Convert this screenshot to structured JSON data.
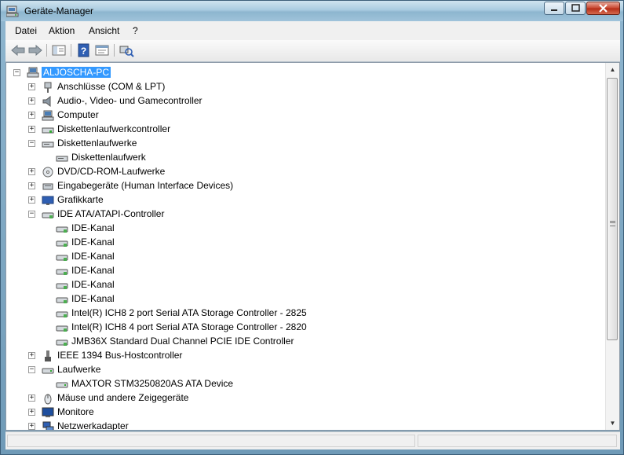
{
  "window": {
    "title": "Geräte-Manager"
  },
  "menu": {
    "items": [
      "Datei",
      "Aktion",
      "Ansicht",
      "?"
    ]
  },
  "tree": {
    "root": "ALJOSCHA-PC",
    "nodes": [
      {
        "label": "Anschlüsse (COM & LPT)",
        "icon": "port-icon",
        "expander": "+"
      },
      {
        "label": "Audio-, Video- und Gamecontroller",
        "icon": "speaker-icon",
        "expander": "+"
      },
      {
        "label": "Computer",
        "icon": "computer-icon",
        "expander": "+"
      },
      {
        "label": "Diskettenlaufwerkcontroller",
        "icon": "floppy-controller-icon",
        "expander": "+"
      },
      {
        "label": "Diskettenlaufwerke",
        "icon": "floppy-drive-icon",
        "expander": "−"
      },
      {
        "label": "Diskettenlaufwerk",
        "icon": "floppy-drive-icon",
        "child": true
      },
      {
        "label": "DVD/CD-ROM-Laufwerke",
        "icon": "dvd-icon",
        "expander": "+"
      },
      {
        "label": "Eingabegeräte (Human Interface Devices)",
        "icon": "hid-icon",
        "expander": "+"
      },
      {
        "label": "Grafikkarte",
        "icon": "display-adapter-icon",
        "expander": "+"
      },
      {
        "label": "IDE ATA/ATAPI-Controller",
        "icon": "ide-controller-icon",
        "expander": "−"
      },
      {
        "label": "IDE-Kanal",
        "icon": "ide-controller-icon",
        "child": true
      },
      {
        "label": "IDE-Kanal",
        "icon": "ide-controller-icon",
        "child": true
      },
      {
        "label": "IDE-Kanal",
        "icon": "ide-controller-icon",
        "child": true
      },
      {
        "label": "IDE-Kanal",
        "icon": "ide-controller-icon",
        "child": true
      },
      {
        "label": "IDE-Kanal",
        "icon": "ide-controller-icon",
        "child": true
      },
      {
        "label": "IDE-Kanal",
        "icon": "ide-controller-icon",
        "child": true
      },
      {
        "label": "Intel(R) ICH8 2 port Serial ATA Storage Controller - 2825",
        "icon": "ide-controller-icon",
        "child": true
      },
      {
        "label": "Intel(R) ICH8 4 port Serial ATA Storage Controller - 2820",
        "icon": "ide-controller-icon",
        "child": true
      },
      {
        "label": "JMB36X Standard Dual Channel PCIE IDE Controller",
        "icon": "ide-controller-icon",
        "child": true
      },
      {
        "label": "IEEE 1394 Bus-Hostcontroller",
        "icon": "firewire-icon",
        "expander": "+"
      },
      {
        "label": "Laufwerke",
        "icon": "disk-drive-icon",
        "expander": "−"
      },
      {
        "label": "MAXTOR STM3250820AS ATA Device",
        "icon": "disk-drive-icon",
        "child": true
      },
      {
        "label": "Mäuse und andere Zeigegeräte",
        "icon": "mouse-icon",
        "expander": "+"
      },
      {
        "label": "Monitore",
        "icon": "monitor-icon",
        "expander": "+"
      },
      {
        "label": "Netzwerkadapter",
        "icon": "network-icon",
        "expander": "+"
      }
    ]
  }
}
